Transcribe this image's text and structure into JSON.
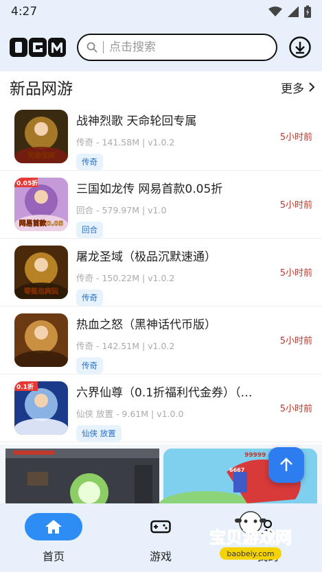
{
  "status": {
    "time": "4:27"
  },
  "header": {
    "logo_text": "UGM",
    "search_placeholder": "点击搜索"
  },
  "section": {
    "title": "新品网游",
    "more": "更多"
  },
  "games": [
    {
      "name": "战神烈歌 天命轮回专属",
      "meta": "传奇 - 141.58M | v1.0.2",
      "tag": "传奇",
      "time": "5小时前",
      "colors": [
        "#3a2a10",
        "#b8862b",
        "#7a1c12"
      ],
      "badge": "天命宝库"
    },
    {
      "name": "三国如龙传 网易首款0.05折",
      "meta": "回合 - 579.97M | v1.0",
      "tag": "回合",
      "time": "5小时前",
      "colors": [
        "#c59ad8",
        "#8e5bb5",
        "#f0d6e8"
      ],
      "badge": "网易首款0.05",
      "corner": "0.05折"
    },
    {
      "name": "屠龙圣域（极品沉默速通）",
      "meta": "传奇 - 150.22M | v1.0.2",
      "tag": "传奇",
      "time": "5小时前",
      "colors": [
        "#4a2a0a",
        "#c9922a",
        "#2a1a08"
      ],
      "badge": "零氪也爽玩"
    },
    {
      "name": "热血之怒（黑神话代币版）",
      "meta": "传奇 - 142.51M | v1.0.2",
      "tag": "传奇",
      "time": "5小时前",
      "colors": [
        "#6b3a12",
        "#d9a04a",
        "#3a1e0a"
      ]
    },
    {
      "name": "六界仙尊（0.1折福利代金券）（…",
      "meta": "仙侠 放置 - 9.61M | v1.0.0",
      "tag": "仙侠 放置",
      "time": "5小时前",
      "colors": [
        "#1c3a8a",
        "#9ec9f2",
        "#eef4ff"
      ],
      "corner": "0.1折"
    }
  ],
  "tabs": [
    {
      "label": "首页",
      "icon": "home-icon",
      "active": true
    },
    {
      "label": "游戏",
      "icon": "gamepad-icon",
      "active": false
    },
    {
      "label": "我的",
      "icon": "user-icon",
      "active": false
    }
  ],
  "watermark": {
    "text": "宝贝游戏网",
    "url": "baobeiy.com"
  },
  "banner": {
    "hp1": "99999",
    "hp2": "6667"
  }
}
